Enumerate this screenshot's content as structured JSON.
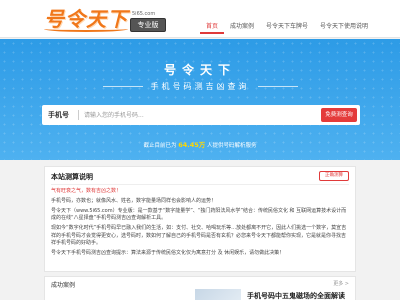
{
  "header": {
    "logo_text": "号令天下",
    "logo_domain": "5i65.com",
    "logo_badge": "专业版",
    "nav": [
      {
        "label": "首页",
        "active": true
      },
      {
        "label": "成功案例",
        "active": false
      },
      {
        "label": "号令天下车牌号",
        "active": false
      },
      {
        "label": "号令天下使用说明",
        "active": false
      }
    ]
  },
  "hero": {
    "title": "号令天下",
    "subtitle": "手机号码测吉凶查询",
    "search": {
      "label": "手机号",
      "placeholder": "请输入您的手机号码...",
      "button": "免费测查询"
    },
    "stats": {
      "prefix": "截止目前已为",
      "count": "64.45万",
      "suffix": "人提供号码解析服务"
    }
  },
  "intro": {
    "title": "本站测算说明",
    "more_button": "正确测算",
    "paragraphs": [
      "气有旺衰之气，数有吉凶之数！",
      "手机号码，亦数也；就像风水、姓名，数字能量场同样也会影响人的运势！",
      "号令天下（www.5i65.com）专业版：是一款基于“数字能量学”、“独门药阳法风水学”结合：传统民俗文化 和 互联网运算技术设计而成的在线“八星择盘”手机号码测吉凶查询解析工具。",
      "现如今“数字化时代”手机号码早已融入我们的生活，如：支付、社交、哈喝玩乐等…放处都离不开它，因此人们挑选一个数字，莫宣吉祥的手机号码才会觉得更安心，选号码时，数如何了解自己的手机号码是否有玄机？必您来号令天下都能帮你实现，它是就是你寻找吉祥手机号码的好助手。",
      "号令天下手机号码测吉凶查询提示：算法来源于传统民俗文化仅为寓意打分 及 休闲娱乐，请勿做此决策！"
    ]
  },
  "cases": {
    "title": "成功案例",
    "more": "更多 >",
    "headline": "手机号码中五鬼磁场的全面解读"
  }
}
